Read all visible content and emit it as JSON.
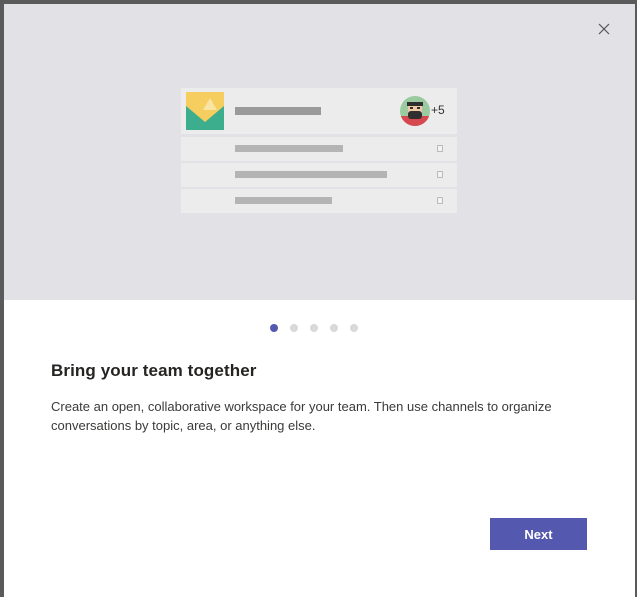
{
  "dialog": {
    "close_icon": "close-icon",
    "illustration": {
      "member_count": "+5",
      "team_avatar_icon": "team-image-icon",
      "member_avatar_icon": "user-avatar-icon",
      "channel_check_icon": "checkbox-icon"
    },
    "pager": {
      "total": 5,
      "current": 1
    },
    "title": "Bring your team together",
    "description": "Create an open, collaborative workspace for your team. Then use channels to organize conversations by topic, area, or anything else.",
    "next_label": "Next"
  },
  "colors": {
    "accent": "#5558af",
    "hero_background": "#e2e2e6",
    "inactive_dot": "#d9d9dc"
  }
}
